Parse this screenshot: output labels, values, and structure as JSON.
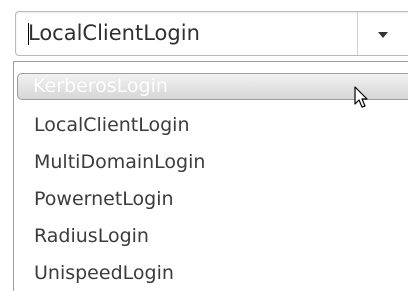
{
  "combo": {
    "value": "LocalClientLogin",
    "dropdown_icon": "chevron-down-icon"
  },
  "list": {
    "items": [
      {
        "label": "KerberosLogin",
        "highlighted": true
      },
      {
        "label": "LocalClientLogin",
        "highlighted": false
      },
      {
        "label": "MultiDomainLogin",
        "highlighted": false
      },
      {
        "label": "PowernetLogin",
        "highlighted": false
      },
      {
        "label": "RadiusLogin",
        "highlighted": false
      },
      {
        "label": "UnispeedLogin",
        "highlighted": false
      }
    ]
  },
  "pointer": {
    "icon": "mouse-pointer-icon"
  }
}
